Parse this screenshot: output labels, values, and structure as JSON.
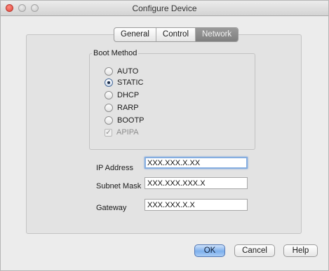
{
  "window": {
    "title": "Configure Device"
  },
  "tabs": [
    {
      "label": "General",
      "active": false
    },
    {
      "label": "Control",
      "active": false
    },
    {
      "label": "Network",
      "active": true
    }
  ],
  "boot_method": {
    "label": "Boot Method",
    "options": [
      {
        "label": "AUTO",
        "checked": false
      },
      {
        "label": "STATIC",
        "checked": true
      },
      {
        "label": "DHCP",
        "checked": false
      },
      {
        "label": "RARP",
        "checked": false
      },
      {
        "label": "BOOTP",
        "checked": false
      }
    ],
    "apipa": {
      "label": "APIPA",
      "checked": true,
      "disabled": true
    }
  },
  "fields": {
    "ip_address": {
      "label": "IP Address",
      "value": "XXX.XXX.X.XX"
    },
    "subnet_mask": {
      "label": "Subnet Mask",
      "value": "XXX.XXX.XXX.X"
    },
    "gateway": {
      "label": "Gateway",
      "value": "XXX.XXX.X.X"
    }
  },
  "buttons": {
    "ok": "OK",
    "cancel": "Cancel",
    "help": "Help"
  }
}
